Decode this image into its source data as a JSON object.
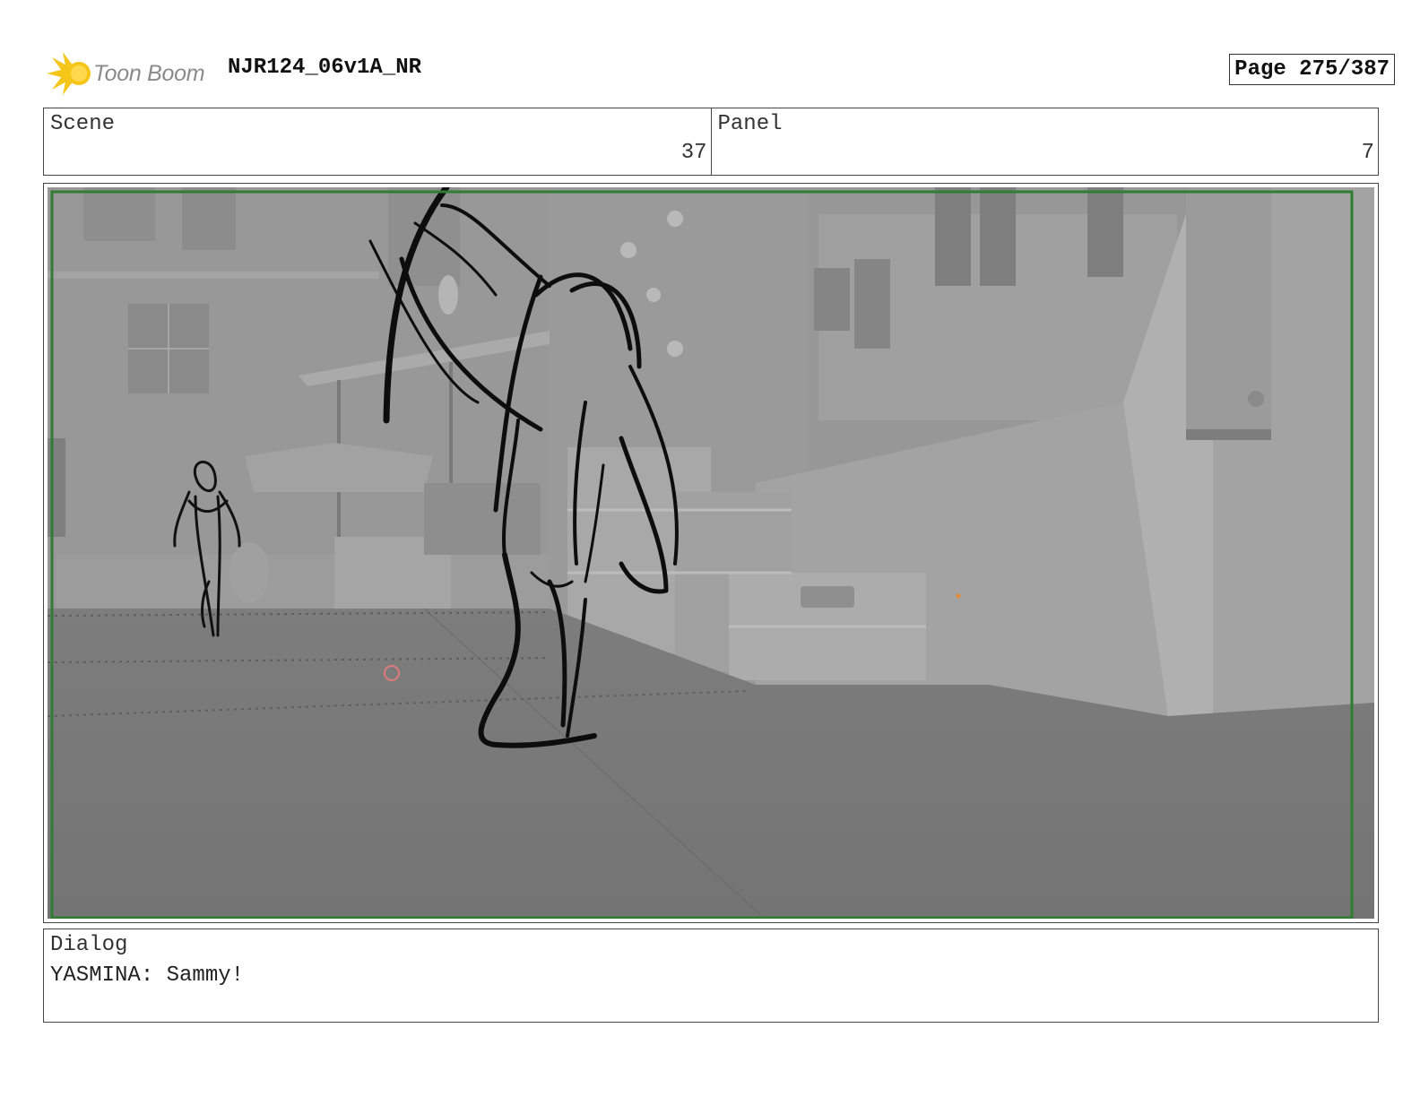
{
  "header": {
    "logo_text": "Toon Boom",
    "title": "NJR124_06v1A_NR",
    "page": "Page 275/387"
  },
  "scene": {
    "label": "Scene",
    "value": "37"
  },
  "panel": {
    "label": "Panel",
    "value": "7"
  },
  "dialog": {
    "label": "Dialog",
    "text": "YASMINA: Sammy!"
  },
  "colors": {
    "safe_frame": "#2e7d32",
    "sketch": "#111111",
    "render_bg": "#8d8d8d"
  },
  "icons": {
    "logo": "toon-boom-logo-icon"
  }
}
